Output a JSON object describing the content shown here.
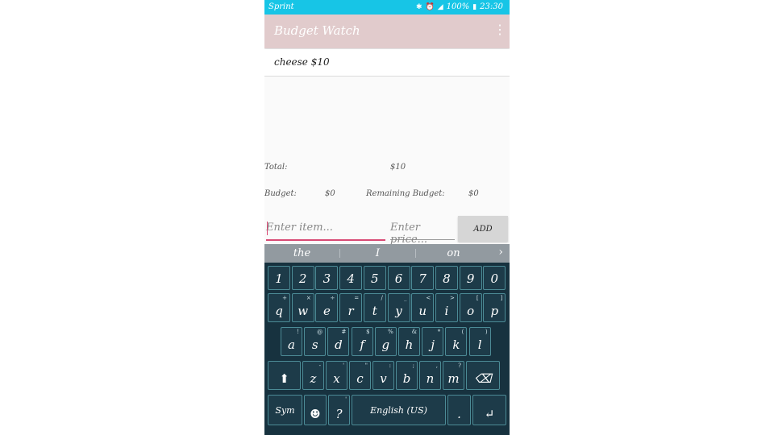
{
  "status_bar": {
    "carrier": "Sprint",
    "battery": "100%",
    "time": "23:30",
    "icons": [
      "bluetooth-icon",
      "alarm-icon",
      "signal-icon",
      "battery-icon"
    ]
  },
  "app_bar": {
    "title": "Budget Watch",
    "menu_icon": "overflow-menu-icon"
  },
  "items": [
    {
      "label": "cheese $10"
    }
  ],
  "summary": {
    "total_label": "Total:",
    "total_value": "$10",
    "budget_label": "Budget:",
    "budget_value": "$0",
    "remaining_label": "Remaining Budget:",
    "remaining_value": "$0"
  },
  "form": {
    "item_placeholder": "Enter item...",
    "price_placeholder": "Enter price...",
    "add_label": "ADD"
  },
  "suggestions": [
    "the",
    "I",
    "on"
  ],
  "keyboard": {
    "rows": [
      [
        {
          "main": "1"
        },
        {
          "main": "2"
        },
        {
          "main": "3"
        },
        {
          "main": "4"
        },
        {
          "main": "5"
        },
        {
          "main": "6"
        },
        {
          "main": "7"
        },
        {
          "main": "8"
        },
        {
          "main": "9"
        },
        {
          "main": "0"
        }
      ],
      [
        {
          "main": "q",
          "sub": "+"
        },
        {
          "main": "w",
          "sub": "×"
        },
        {
          "main": "e",
          "sub": "÷"
        },
        {
          "main": "r",
          "sub": "="
        },
        {
          "main": "t",
          "sub": "/"
        },
        {
          "main": "y",
          "sub": "_"
        },
        {
          "main": "u",
          "sub": "<"
        },
        {
          "main": "i",
          "sub": ">"
        },
        {
          "main": "o",
          "sub": "["
        },
        {
          "main": "p",
          "sub": "]"
        }
      ],
      [
        {
          "main": "a",
          "sub": "!"
        },
        {
          "main": "s",
          "sub": "@"
        },
        {
          "main": "d",
          "sub": "#"
        },
        {
          "main": "f",
          "sub": "$"
        },
        {
          "main": "g",
          "sub": "%"
        },
        {
          "main": "h",
          "sub": "&"
        },
        {
          "main": "j",
          "sub": "*"
        },
        {
          "main": "k",
          "sub": "("
        },
        {
          "main": "l",
          "sub": ")"
        }
      ],
      [
        {
          "main": "⬆",
          "icon": "shift-icon"
        },
        {
          "main": "z",
          "sub": "-"
        },
        {
          "main": "x",
          "sub": "'"
        },
        {
          "main": "c",
          "sub": "\""
        },
        {
          "main": "v",
          "sub": ":"
        },
        {
          "main": "b",
          "sub": ";"
        },
        {
          "main": "n",
          "sub": ","
        },
        {
          "main": "m",
          "sub": "?"
        },
        {
          "main": "⌫",
          "icon": "backspace-icon"
        }
      ],
      [
        {
          "main": "Sym"
        },
        {
          "main": "☻",
          "icon": "emoji-icon"
        },
        {
          "main": "?",
          "sub": "'"
        },
        {
          "main": "English (US)"
        },
        {
          "main": "."
        },
        {
          "main": "↵",
          "icon": "enter-icon"
        }
      ]
    ]
  },
  "colors": {
    "status_bar": "#17c5e6",
    "app_bar": "#e1cbcc",
    "accent": "#d84a74",
    "keyboard_bg": "#17323f",
    "key_border": "#4c8b96"
  }
}
